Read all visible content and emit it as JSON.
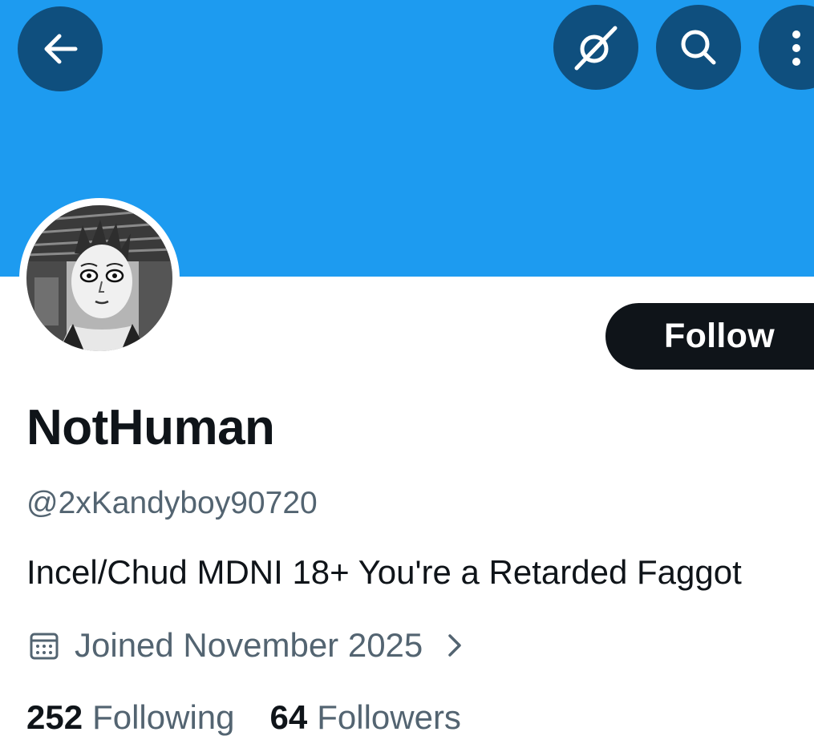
{
  "header": {
    "banner_color": "#1d9bf0",
    "button_color": "#0f4f7e",
    "back_icon": "arrow-left-icon",
    "grok_icon": "grok-icon",
    "search_icon": "search-icon",
    "more_icon": "more-vertical-icon"
  },
  "profile": {
    "display_name": "NotHuman",
    "handle": "@2xKandyboy90720",
    "bio": "Incel/Chud MDNI 18+ You're a Retarded Faggot",
    "joined": "Joined November 2025",
    "follow_label": "Follow",
    "following_count": "252",
    "following_label": "Following",
    "followers_count": "64",
    "followers_label": "Followers"
  }
}
